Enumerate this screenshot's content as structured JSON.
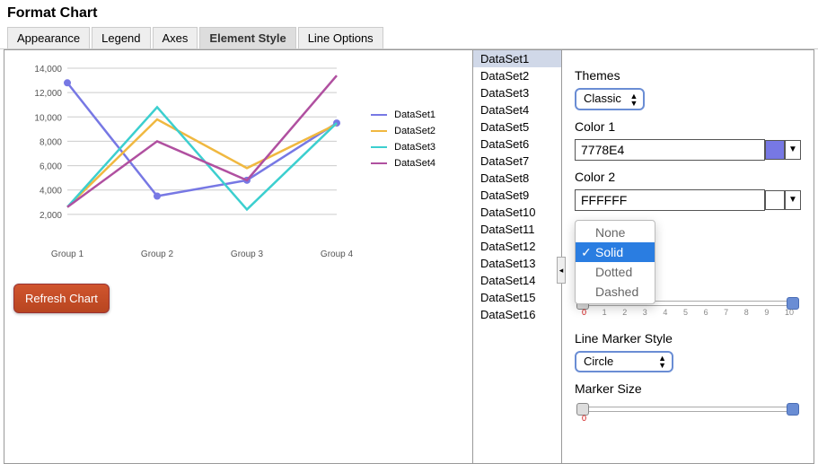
{
  "title": "Format Chart",
  "tabs": [
    "Appearance",
    "Legend",
    "Axes",
    "Element Style",
    "Line Options"
  ],
  "active_tab": "Element Style",
  "refresh_label": "Refresh Chart",
  "datasets": [
    "DataSet1",
    "DataSet2",
    "DataSet3",
    "DataSet4",
    "DataSet5",
    "DataSet6",
    "DataSet7",
    "DataSet8",
    "DataSet9",
    "DataSet10",
    "DataSet11",
    "DataSet12",
    "DataSet13",
    "DataSet14",
    "DataSet15",
    "DataSet16"
  ],
  "selected_dataset": "DataSet1",
  "themes_label": "Themes",
  "themes_value": "Classic",
  "color1_label": "Color 1",
  "color1_value": "7778E4",
  "color1_hex": "#7778E4",
  "color2_label": "Color 2",
  "color2_value": "FFFFFF",
  "color2_hex": "#FFFFFF",
  "line_style_options": [
    "None",
    "Solid",
    "Dotted",
    "Dashed"
  ],
  "line_style_selected": "Solid",
  "slider1_ticks": [
    "0",
    "1",
    "2",
    "3",
    "4",
    "5",
    "6",
    "7",
    "8",
    "9",
    "10"
  ],
  "marker_style_label": "Line Marker Style",
  "marker_style_value": "Circle",
  "marker_size_label": "Marker Size",
  "slider2_zero": "0",
  "chart_data": {
    "type": "line",
    "categories": [
      "Group 1",
      "Group 2",
      "Group 3",
      "Group 4"
    ],
    "ylim": [
      0,
      14000
    ],
    "yticks": [
      2000,
      4000,
      6000,
      8000,
      10000,
      12000,
      14000
    ],
    "ytick_labels": [
      "2,000",
      "4,000",
      "6,000",
      "8,000",
      "10,000",
      "12,000",
      "14,000"
    ],
    "series": [
      {
        "name": "DataSet1",
        "color": "#7778E4",
        "values": [
          12800,
          3500,
          4800,
          9500
        ],
        "marker": "circle"
      },
      {
        "name": "DataSet2",
        "color": "#f0b840",
        "values": [
          2600,
          9800,
          5800,
          9400
        ]
      },
      {
        "name": "DataSet3",
        "color": "#3ccfcf",
        "values": [
          2600,
          10800,
          2400,
          9500
        ]
      },
      {
        "name": "DataSet4",
        "color": "#b050a0",
        "values": [
          2600,
          8000,
          4800,
          13400
        ]
      }
    ]
  }
}
